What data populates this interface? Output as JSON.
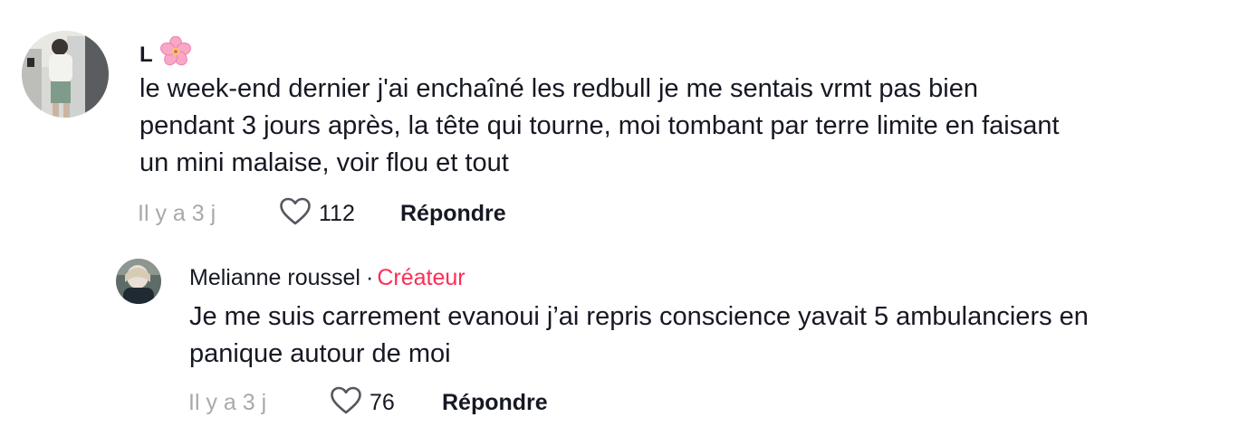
{
  "comments": [
    {
      "username": "L",
      "username_emoji": "cherry-blossom-icon",
      "text_lines": [
        "le week-end dernier j'ai enchaîné les redbull je me sentais vrmt pas bien",
        "pendant 3 jours après, la tête qui tourne, moi tombant par terre limite en faisant",
        "un mini malaise, voir flou et tout"
      ],
      "time": "Il y a 3 j",
      "likes": "112",
      "reply_label": "Répondre"
    },
    {
      "username": "Melianne roussel",
      "separator": "·",
      "badge": "Créateur",
      "text_lines": [
        "Je me suis carrement evanoui j’ai repris conscience yavait 5 ambulanciers en",
        "panique autour de moi"
      ],
      "time": "Il y a 3 j",
      "likes": "76",
      "reply_label": "Répondre"
    }
  ],
  "colors": {
    "text": "#161823",
    "muted": "#a8a9ad",
    "creator_badge": "#fe2c55"
  }
}
